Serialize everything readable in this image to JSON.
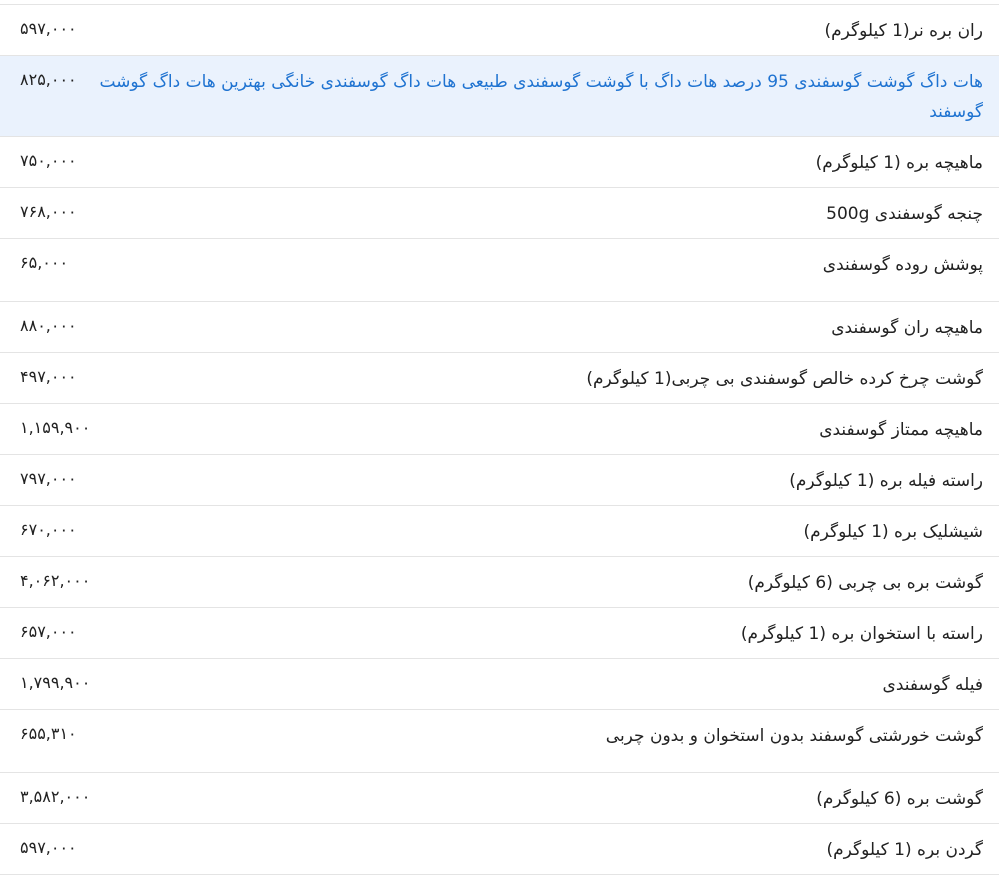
{
  "rows": [
    {
      "name": "ران بره نر(1 کیلوگرم)",
      "price": "۵۹۷,۰۰۰"
    },
    {
      "name": "هات داگ گوشت گوسفندی 95 درصد هات داگ با گوشت گوسفندی طبیعی هات داگ گوسفندی خانگی بهترین هات داگ گوشت گوسفند",
      "price": "۸۲۵,۰۰۰",
      "highlight": true
    },
    {
      "name": "ماهیچه بره (1 کیلوگرم)",
      "price": "۷۵۰,۰۰۰"
    },
    {
      "name": "چنجه گوسفندی 500g",
      "price": "۷۶۸,۰۰۰"
    },
    {
      "name": "پوشش روده گوسفندی",
      "price": "۶۵,۰۰۰"
    },
    {
      "name": "ماهیچه ران گوسفندی",
      "price": "۸۸۰,۰۰۰"
    },
    {
      "name": "گوشت چرخ کرده خالص گوسفندی بی چربی(1 کیلوگرم)",
      "price": "۴۹۷,۰۰۰"
    },
    {
      "name": "ماهیچه ممتاز گوسفندی",
      "price": "۱,۱۵۹,۹۰۰"
    },
    {
      "name": "راسته فیله بره (1 کیلوگرم)",
      "price": "۷۹۷,۰۰۰"
    },
    {
      "name": "شیشلیک بره (1 کیلوگرم)",
      "price": "۶۷۰,۰۰۰"
    },
    {
      "name": "گوشت بره بی چربی (6 کیلوگرم)",
      "price": "۴,۰۶۲,۰۰۰"
    },
    {
      "name": "راسته با استخوان بره (1 کیلوگرم)",
      "price": "۶۵۷,۰۰۰"
    },
    {
      "name": "فیله گوسفندی",
      "price": "۱,۷۹۹,۹۰۰"
    },
    {
      "name": "گوشت خورشتی گوسفند بدون استخوان و بدون چربی",
      "price": "۶۵۵,۳۱۰"
    },
    {
      "name": "گوشت بره (6 کیلوگرم)",
      "price": "۳,۵۸۲,۰۰۰"
    },
    {
      "name": "گردن بره (1 کیلوگرم)",
      "price": "۵۹۷,۰۰۰"
    }
  ],
  "colors": {
    "highlight_bg": "#eaf2fd",
    "highlight_text": "#1f73d1",
    "divider": "#e4e4e4"
  }
}
